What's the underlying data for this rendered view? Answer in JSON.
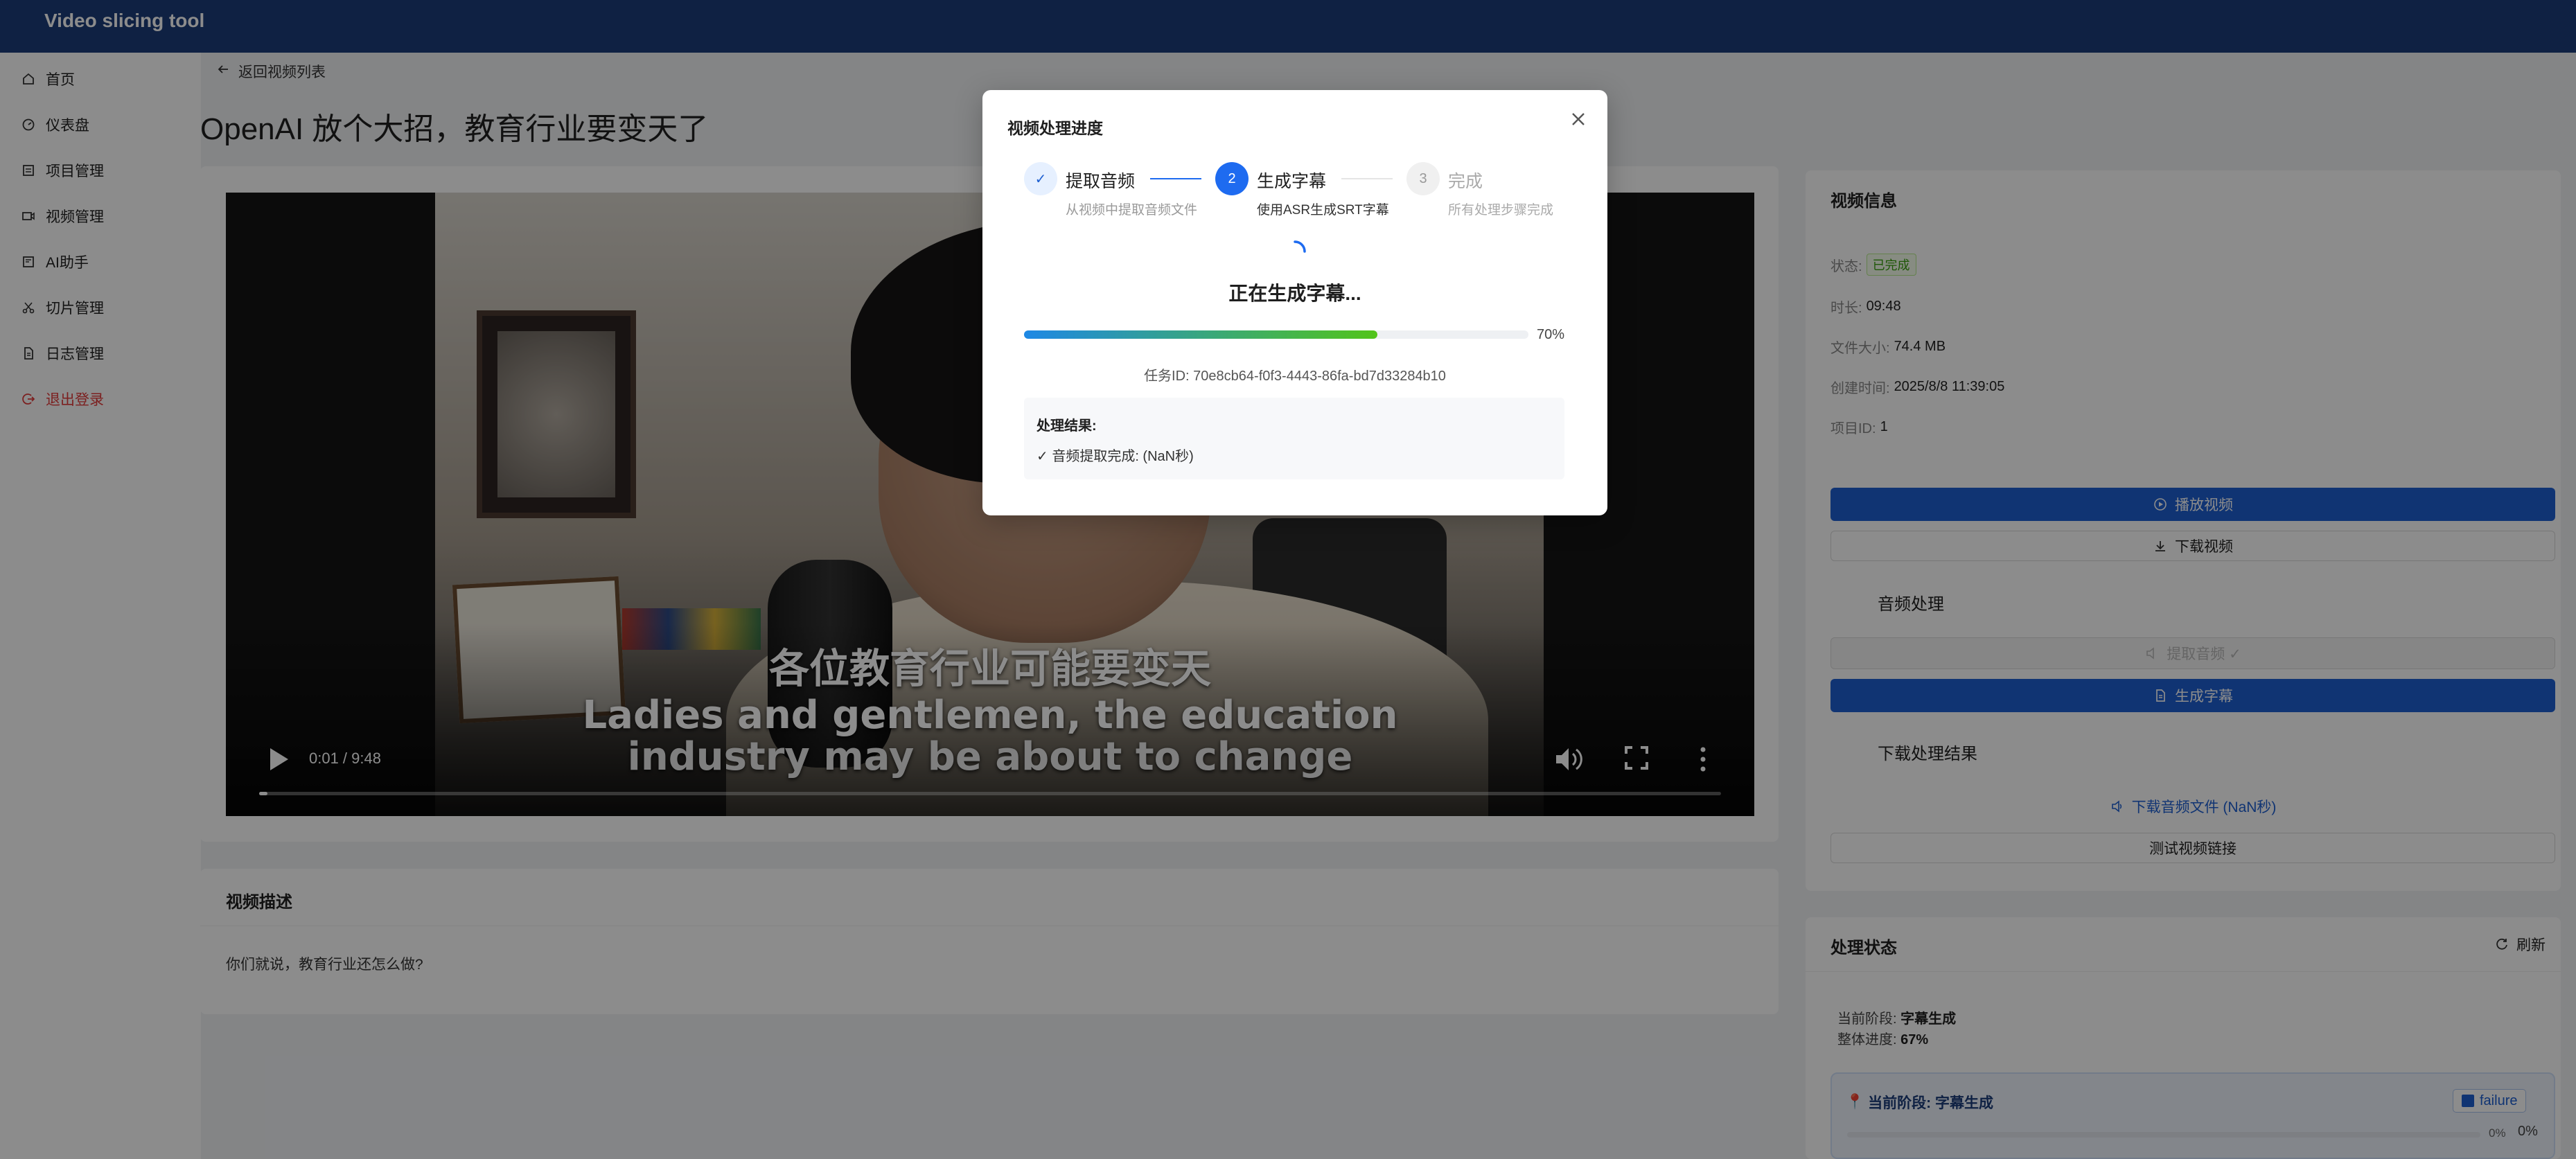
{
  "app": {
    "title": "Video slicing tool"
  },
  "sidebar": {
    "items": [
      {
        "label": "首页",
        "icon": "home-icon"
      },
      {
        "label": "仪表盘",
        "icon": "dashboard-icon"
      },
      {
        "label": "项目管理",
        "icon": "project-icon"
      },
      {
        "label": "视频管理",
        "icon": "video-icon"
      },
      {
        "label": "AI助手",
        "icon": "ai-icon"
      },
      {
        "label": "切片管理",
        "icon": "scissors-icon"
      },
      {
        "label": "日志管理",
        "icon": "log-icon"
      },
      {
        "label": "退出登录",
        "icon": "logout-icon"
      }
    ]
  },
  "main": {
    "back_label": "返回视频列表",
    "title": "OpenAI 放个大招，教育行业要变天了",
    "player": {
      "subtitle_cn": "各位教育行业可能要变天",
      "subtitle_en_1": "Ladies and gentlemen, the education",
      "subtitle_en_2": "industry may be about to change",
      "time": "0:01 / 9:48",
      "played_fraction": 0.002
    },
    "description": {
      "title": "视频描述",
      "text": "你们就说，教育行业还怎么做?"
    }
  },
  "info": {
    "title": "视频信息",
    "status_label": "状态:",
    "status_value": "已完成",
    "duration_label": "时长:",
    "duration_value": "09:48",
    "size_label": "文件大小:",
    "size_value": "74.4 MB",
    "created_label": "创建时间:",
    "created_value": "2025/8/8 11:39:05",
    "project_label": "项目ID:",
    "project_value": "1",
    "play_button": "播放视频",
    "download_button": "下载视频",
    "audio_section": "音频处理",
    "extract_audio_button": "提取音频 ✓",
    "gen_subtitle_button": "生成字幕",
    "download_section": "下载处理结果",
    "download_audio_link": "下载音频文件 (NaN秒)",
    "test_link_button": "测试视频链接"
  },
  "status": {
    "title": "处理状态",
    "refresh_label": "刷新",
    "stage_label": "当前阶段:",
    "stage_value": "字幕生成",
    "overall_label": "整体进度:",
    "overall_value": "67%",
    "current_stage_title": "当前阶段: 字幕生成",
    "badge": "failure",
    "stage_percent_small": "0%",
    "stage_percent": "0%",
    "stage_progress": 0
  },
  "modal": {
    "title": "视频处理进度",
    "steps": [
      {
        "number": "✓",
        "title": "提取音频",
        "desc": "从视频中提取音频文件",
        "state": "done"
      },
      {
        "number": "2",
        "title": "生成字幕",
        "desc": "使用ASR生成SRT字幕",
        "state": "active"
      },
      {
        "number": "3",
        "title": "完成",
        "desc": "所有处理步骤完成",
        "state": "wait"
      }
    ],
    "processing_text": "正在生成字幕...",
    "progress": 0.7,
    "progress_label": "70%",
    "task_id": "任务ID: 70e8cb64-f0f3-4443-86fa-bd7d33284b10",
    "result_title": "处理结果:",
    "result_line": "✓ 音频提取完成: (NaN秒)"
  },
  "colors": {
    "header": "#1c3d7a",
    "primary": "#1e5fd1",
    "danger": "#e23b3b",
    "success": "#389e0d"
  }
}
